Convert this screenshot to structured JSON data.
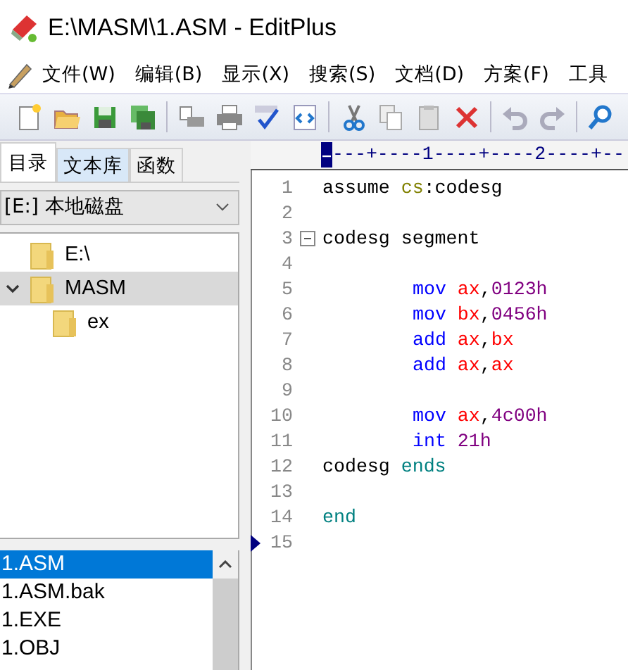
{
  "window": {
    "title": "E:\\MASM\\1.ASM - EditPlus"
  },
  "menu": [
    "文件(W)",
    "编辑(B)",
    "显示(X)",
    "搜索(S)",
    "文档(D)",
    "方案(F)",
    "工具"
  ],
  "sidebar": {
    "tabs": [
      {
        "label": "目录",
        "selected": true
      },
      {
        "label": "文本库",
        "selected": false
      },
      {
        "label": "函数",
        "selected": false
      }
    ],
    "drive": {
      "value": "[E:] 本地磁盘"
    },
    "tree": [
      {
        "label": "E:\\",
        "selected": false
      },
      {
        "label": "MASM",
        "expanded": true,
        "selected": true,
        "children": [
          {
            "label": "ex",
            "selected": false
          }
        ]
      }
    ],
    "files": [
      {
        "name": "1.ASM",
        "selected": true
      },
      {
        "name": "1.ASM.bak",
        "selected": false
      },
      {
        "name": "1.EXE",
        "selected": false
      },
      {
        "name": "1.OBJ",
        "selected": false
      }
    ]
  },
  "editor": {
    "ruler": "---+----1----+----2----+--",
    "lines": [
      {
        "number": "1",
        "indented": false,
        "tokens": [
          {
            "kind": "text",
            "text": "assume "
          },
          {
            "kind": "segment",
            "text": "cs"
          },
          {
            "kind": "text",
            "text": ":codesg"
          }
        ]
      },
      {
        "number": "2"
      },
      {
        "number": "3",
        "indented": false,
        "fold": true,
        "tokens": [
          {
            "kind": "text",
            "text": "codesg segment"
          }
        ]
      },
      {
        "number": "4"
      },
      {
        "number": "5",
        "indented": true,
        "tokens": [
          {
            "kind": "keyword",
            "text": "mov "
          },
          {
            "kind": "register",
            "text": "ax"
          },
          {
            "kind": "text",
            "text": ","
          },
          {
            "kind": "number",
            "text": "0123h"
          }
        ]
      },
      {
        "number": "6",
        "indented": true,
        "tokens": [
          {
            "kind": "keyword",
            "text": "mov "
          },
          {
            "kind": "register",
            "text": "bx"
          },
          {
            "kind": "text",
            "text": ","
          },
          {
            "kind": "number",
            "text": "0456h"
          }
        ]
      },
      {
        "number": "7",
        "indented": true,
        "tokens": [
          {
            "kind": "keyword",
            "text": "add "
          },
          {
            "kind": "register",
            "text": "ax"
          },
          {
            "kind": "text",
            "text": ","
          },
          {
            "kind": "register",
            "text": "bx"
          }
        ]
      },
      {
        "number": "8",
        "indented": true,
        "tokens": [
          {
            "kind": "keyword",
            "text": "add "
          },
          {
            "kind": "register",
            "text": "ax"
          },
          {
            "kind": "text",
            "text": ","
          },
          {
            "kind": "register",
            "text": "ax"
          }
        ]
      },
      {
        "number": "9"
      },
      {
        "number": "10",
        "indented": true,
        "tokens": [
          {
            "kind": "keyword",
            "text": "mov "
          },
          {
            "kind": "register",
            "text": "ax"
          },
          {
            "kind": "text",
            "text": ","
          },
          {
            "kind": "number",
            "text": "4c00h"
          }
        ]
      },
      {
        "number": "11",
        "indented": true,
        "tokens": [
          {
            "kind": "keyword",
            "text": "int "
          },
          {
            "kind": "number",
            "text": "21h"
          }
        ]
      },
      {
        "number": "12",
        "indented": false,
        "tokens": [
          {
            "kind": "text",
            "text": "codesg "
          },
          {
            "kind": "directive",
            "text": "ends"
          }
        ]
      },
      {
        "number": "13"
      },
      {
        "number": "14",
        "indented": false,
        "tokens": [
          {
            "kind": "directive",
            "text": "end"
          }
        ]
      },
      {
        "number": "15",
        "current": true
      }
    ]
  }
}
